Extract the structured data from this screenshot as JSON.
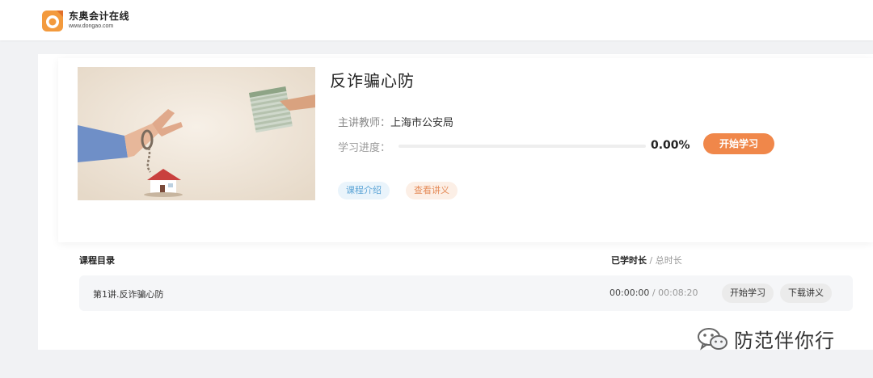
{
  "header": {
    "logo_name": "东奥会计在线",
    "logo_url": "www.dongao.com",
    "logo_icon": "dongao-logo-icon"
  },
  "course": {
    "title": "反诈骗心防",
    "teacher_label": "主讲教师：",
    "teacher_name": "上海市公安局",
    "progress_label": "学习进度：",
    "progress_value": 0.0,
    "progress_text": "0.00%",
    "start_button": "开始学习",
    "intro_tag": "课程介绍",
    "notes_tag": "查看讲义",
    "thumbnail_icon": "handcuffed-hand-money-house-image"
  },
  "catalog": {
    "title": "课程目录",
    "duration_label_learned": "已学时长",
    "duration_separator": " / ",
    "duration_label_total": "总时长",
    "lessons": [
      {
        "title": "第1讲.反诈骗心防",
        "learned": "00:00:00",
        "separator": " / ",
        "total": "00:08:20",
        "start_label": "开始学习",
        "download_label": "下载讲义"
      }
    ]
  },
  "watermark": {
    "text": "防范伴你行",
    "icon": "wechat-icon"
  },
  "colors": {
    "accent": "#f0874a",
    "intro_tag_bg": "#eaf4fb",
    "notes_tag_bg": "#fcefe6",
    "page_bg": "#f1f2f4"
  }
}
